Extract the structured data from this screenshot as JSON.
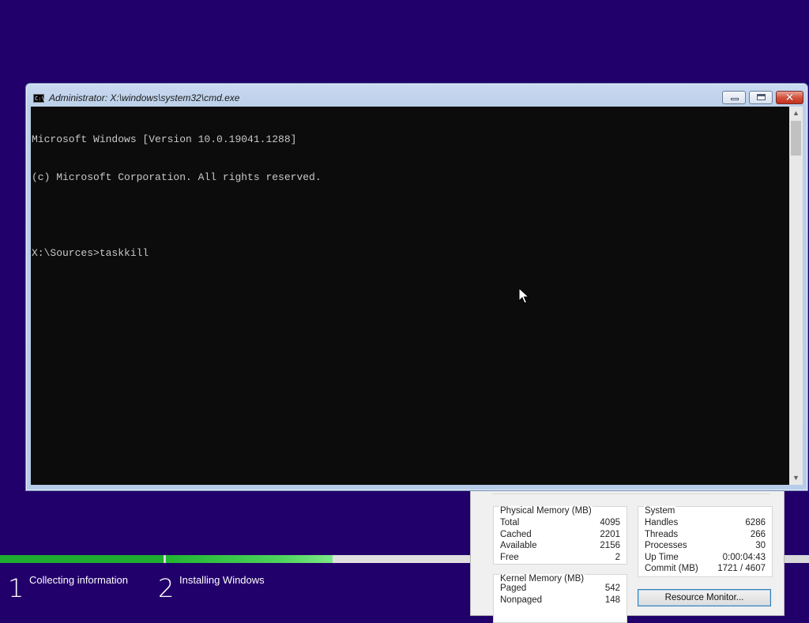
{
  "setup": {
    "steps": [
      {
        "number": "1",
        "label": "Collecting information"
      },
      {
        "number": "2",
        "label": "Installing Windows"
      }
    ],
    "progress": {
      "step1_fraction": 1.0,
      "step2_fraction": 0.55
    }
  },
  "task_manager": {
    "physical_memory": {
      "title": "Physical Memory (MB)",
      "rows": [
        {
          "label": "Total",
          "value": "4095"
        },
        {
          "label": "Cached",
          "value": "2201"
        },
        {
          "label": "Available",
          "value": "2156"
        },
        {
          "label": "Free",
          "value": "2"
        }
      ]
    },
    "system": {
      "title": "System",
      "rows": [
        {
          "label": "Handles",
          "value": "6286"
        },
        {
          "label": "Threads",
          "value": "266"
        },
        {
          "label": "Processes",
          "value": "30"
        },
        {
          "label": "Up Time",
          "value": "0:00:04:43"
        },
        {
          "label": "Commit (MB)",
          "value": "1721 / 4607"
        }
      ]
    },
    "kernel_memory": {
      "title": "Kernel Memory (MB)",
      "rows": [
        {
          "label": "Paged",
          "value": "542"
        },
        {
          "label": "Nonpaged",
          "value": "148"
        }
      ]
    },
    "resource_monitor_button": "Resource Monitor..."
  },
  "cmd": {
    "title": "Administrator: X:\\windows\\system32\\cmd.exe",
    "icon_text": "C:\\",
    "lines": [
      "Microsoft Windows [Version 10.0.19041.1288]",
      "(c) Microsoft Corporation. All rights reserved.",
      "",
      "X:\\Sources>taskkill"
    ],
    "close_glyph": "✕"
  },
  "icons": {
    "minimize": "minimize-icon",
    "maximize": "maximize-icon",
    "close": "close-icon",
    "cursor": "mouse-pointer-icon"
  },
  "colors": {
    "desktop_background": "#22006b",
    "progress_green": "#1fad2f",
    "console_background": "#0c0c0c",
    "console_text": "#c8c8c8"
  }
}
